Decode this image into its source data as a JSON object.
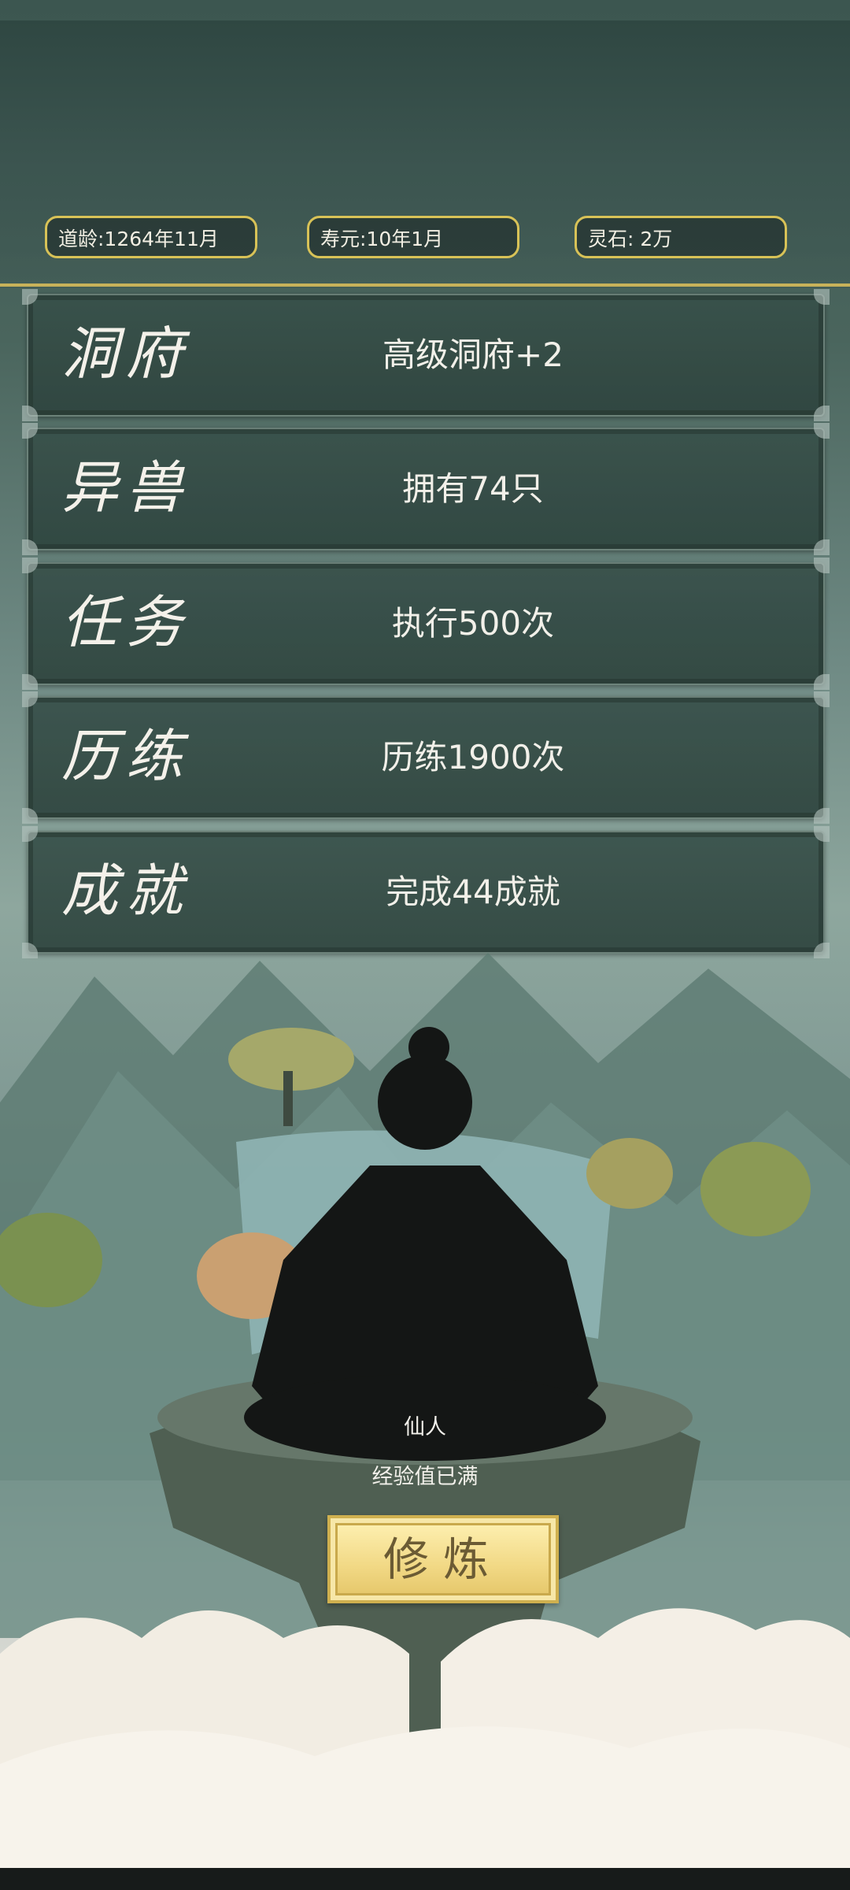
{
  "status": {
    "dao_age": "道龄:1264年11月",
    "lifespan": "寿元:10年1月",
    "spirit_stone": "灵石: 2万"
  },
  "panels": [
    {
      "title": "洞府",
      "value": "高级洞府+2"
    },
    {
      "title": "异兽",
      "value": "拥有74只"
    },
    {
      "title": "任务",
      "value": "执行500次"
    },
    {
      "title": "历练",
      "value": "历练1900次"
    },
    {
      "title": "成就",
      "value": "完成44成就"
    }
  ],
  "character": {
    "name": "仙人",
    "status": "经验值已满"
  },
  "actions": {
    "cultivate_label": "修炼"
  }
}
